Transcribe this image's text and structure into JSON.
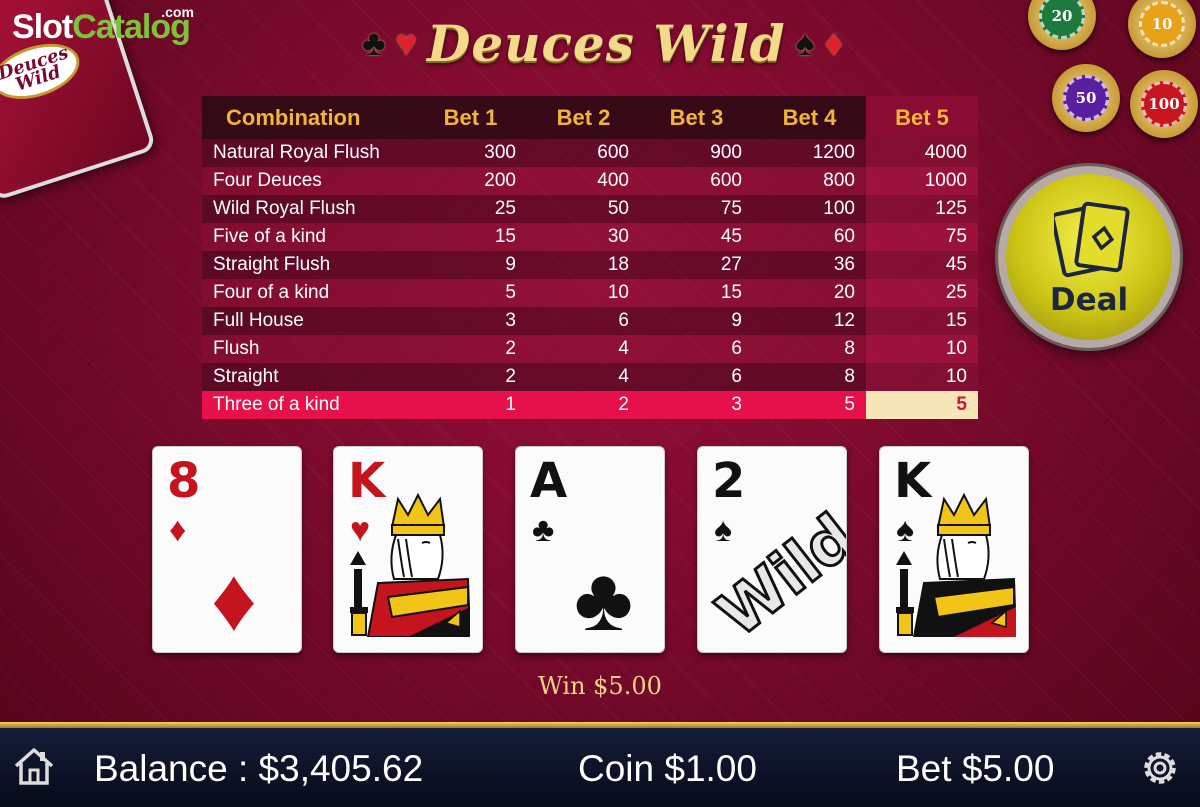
{
  "brand": {
    "slot": "Slot",
    "catalog": "Catalog",
    "dotcom": ".com"
  },
  "corner_card": {
    "logo_text": "Deuces Wild"
  },
  "title": {
    "text": "Deuces Wild",
    "left_suits": [
      "♣",
      "♥"
    ],
    "right_suits": [
      "♠",
      "♦"
    ]
  },
  "paytable": {
    "headers": [
      "Combination",
      "Bet 1",
      "Bet 2",
      "Bet 3",
      "Bet 4",
      "Bet 5"
    ],
    "rows": [
      [
        "Natural Royal Flush",
        "300",
        "600",
        "900",
        "1200",
        "4000"
      ],
      [
        "Four Deuces",
        "200",
        "400",
        "600",
        "800",
        "1000"
      ],
      [
        "Wild Royal Flush",
        "25",
        "50",
        "75",
        "100",
        "125"
      ],
      [
        "Five of a kind",
        "15",
        "30",
        "45",
        "60",
        "75"
      ],
      [
        "Straight Flush",
        "9",
        "18",
        "27",
        "36",
        "45"
      ],
      [
        "Four of a kind",
        "5",
        "10",
        "15",
        "20",
        "25"
      ],
      [
        "Full House",
        "3",
        "6",
        "9",
        "12",
        "15"
      ],
      [
        "Flush",
        "2",
        "4",
        "6",
        "8",
        "10"
      ],
      [
        "Straight",
        "2",
        "4",
        "6",
        "8",
        "10"
      ],
      [
        "Three of a kind",
        "1",
        "2",
        "3",
        "5",
        "5"
      ]
    ],
    "active_column": "Bet 5",
    "winning_row": "Three of a kind"
  },
  "chips": [
    {
      "value": "20",
      "color": "#1e7a3c"
    },
    {
      "value": "10",
      "color": "#e8a21a"
    },
    {
      "value": "50",
      "color": "#5a1ea0"
    },
    {
      "value": "100",
      "color": "#c8161e"
    }
  ],
  "deal_button": {
    "label": "Deal",
    "icon": "cards-icon"
  },
  "cards": [
    {
      "rank": "8",
      "suit": "♦",
      "color": "red",
      "type": "pip"
    },
    {
      "rank": "K",
      "suit": "♥",
      "color": "red",
      "type": "king"
    },
    {
      "rank": "A",
      "suit": "♣",
      "color": "black",
      "type": "pip"
    },
    {
      "rank": "2",
      "suit": "♠",
      "color": "black",
      "type": "wild",
      "wild_label": "Wild"
    },
    {
      "rank": "K",
      "suit": "♠",
      "color": "black",
      "type": "king"
    }
  ],
  "win": {
    "text": "Win $5.00"
  },
  "bottom_bar": {
    "balance": "Balance : $3,405.62",
    "coin": "Coin $1.00",
    "bet": "Bet $5.00",
    "home_icon": "home-icon",
    "settings_icon": "gear-icon"
  },
  "colors": {
    "felt": "#7a0a2c",
    "gold_text": "#f1b53a",
    "highlight_row": "#e6104a",
    "win_cell": "#f6e6b8",
    "deal_yellow": "#e4dc2a",
    "bottom_bar": "#0d1430"
  }
}
